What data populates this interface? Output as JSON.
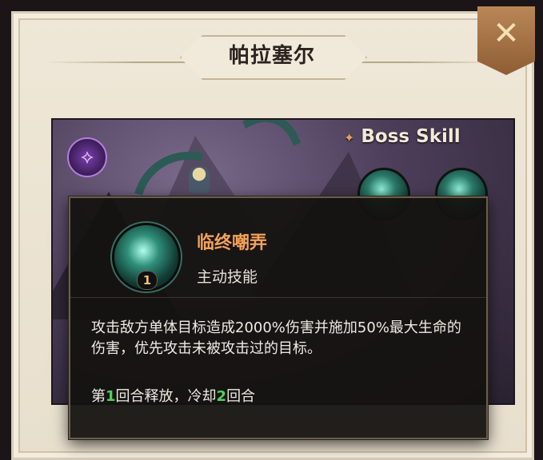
{
  "dialog": {
    "title": "帕拉塞尔",
    "close_icon": "crossed-swords-close-icon"
  },
  "scene": {
    "faction_icon": "purple-faction-icon",
    "boss_label": "Boss Skill",
    "boss_star_icon": "star-icon",
    "skill_icons": [
      "tentacle-skill-icon",
      "tentacle-skill-icon"
    ]
  },
  "tooltip": {
    "skill_name": "临终嘲弄",
    "skill_type": "主动技能",
    "level": "1",
    "description": "攻击敌方单体目标造成2000%伤害并施加50%最大生命的伤害，优先攻击未被攻击过的目标。",
    "cooldown": {
      "prefix": "第",
      "release_round": "1",
      "middle": "回合释放，冷却",
      "cooldown_rounds": "2",
      "suffix": "回合"
    },
    "name_color": "#f2a25a",
    "number_color": "#4fd25a"
  }
}
